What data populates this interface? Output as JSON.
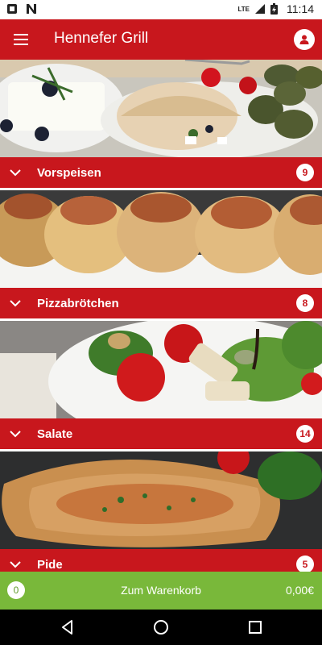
{
  "status_bar": {
    "time": "11:14",
    "network": "LTE",
    "left_icons": [
      "notification-box-icon",
      "n-app-icon"
    ],
    "right_icons": [
      "signal-icon",
      "battery-icon"
    ]
  },
  "app_bar": {
    "title": "Hennefer Grill",
    "menu_icon": "hamburger-menu-icon",
    "profile_icon": "user-profile-icon",
    "color": "#c8171d"
  },
  "categories": [
    {
      "label": "Vorspeisen",
      "count": "9",
      "image": "feta-pita-dolma-photo"
    },
    {
      "label": "Pizzabrötchen",
      "count": "8",
      "image": "pizza-rolls-photo"
    },
    {
      "label": "Salate",
      "count": "14",
      "image": "chicken-salad-photo"
    },
    {
      "label": "Pide",
      "count": "5",
      "image": "pide-flatbread-photo"
    }
  ],
  "cart": {
    "count": "0",
    "label": "Zum Warenkorb",
    "total": "0,00€",
    "color": "#79b83a"
  },
  "nav_bar": {
    "buttons": [
      "back-icon",
      "home-icon",
      "recents-icon"
    ]
  }
}
